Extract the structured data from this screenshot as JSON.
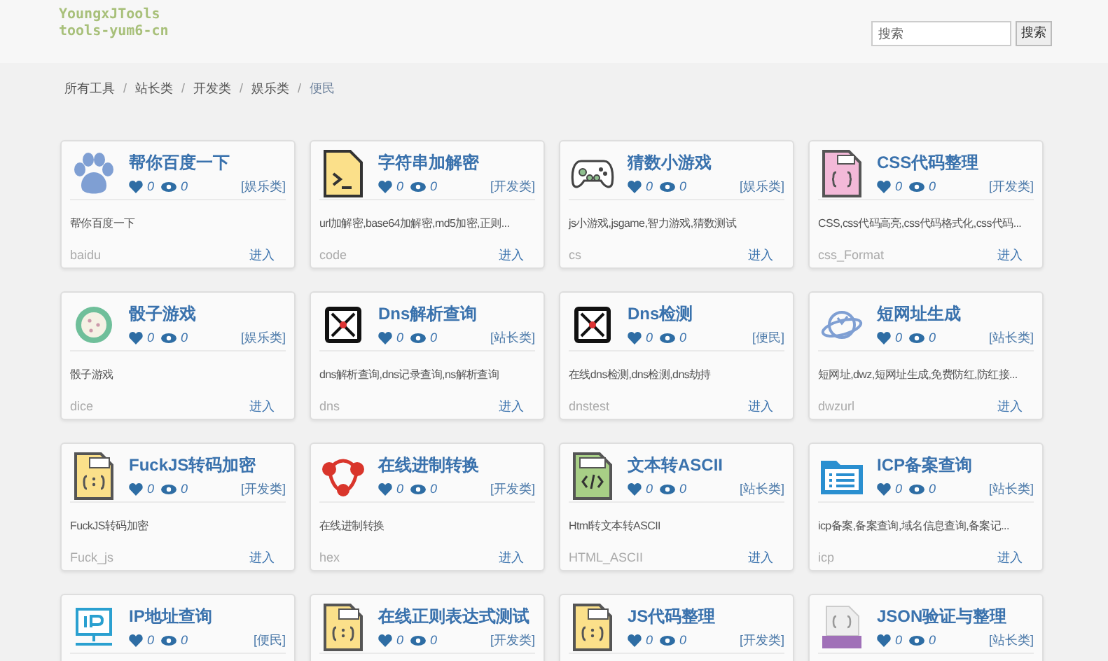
{
  "logo": {
    "name": "YoungxJTools",
    "domain": "tools-yum6-cn"
  },
  "search": {
    "placeholder": "搜索",
    "button": "搜索"
  },
  "breadcrumb": {
    "separator": "/",
    "items": [
      "所有工具",
      "站长类",
      "开发类",
      "娱乐类",
      "便民"
    ]
  },
  "cards": [
    {
      "title": "帮你百度一下",
      "likes": "0",
      "views": "0",
      "category": "[娱乐类]",
      "description": "帮你百度一下",
      "slug": "baidu",
      "link": "进入"
    },
    {
      "title": "字符串加解密",
      "likes": "0",
      "views": "0",
      "category": "[开发类]",
      "description": "url加解密,base64加解密,md5加密,正则...",
      "slug": "code",
      "link": "进入"
    },
    {
      "title": "猜数小游戏",
      "likes": "0",
      "views": "0",
      "category": "[娱乐类]",
      "description": "js小游戏,jsgame,智力游戏,猜数测试",
      "slug": "cs",
      "link": "进入"
    },
    {
      "title": "CSS代码整理",
      "likes": "0",
      "views": "0",
      "category": "[开发类]",
      "description": "CSS,css代码高亮,css代码格式化,css代码...",
      "slug": "css_Format",
      "link": "进入"
    },
    {
      "title": "骰子游戏",
      "likes": "0",
      "views": "0",
      "category": "[娱乐类]",
      "description": "骰子游戏",
      "slug": "dice",
      "link": "进入"
    },
    {
      "title": "Dns解析查询",
      "likes": "0",
      "views": "0",
      "category": "[站长类]",
      "description": "dns解析查询,dns记录查询,ns解析查询",
      "slug": "dns",
      "link": "进入"
    },
    {
      "title": "Dns检测",
      "likes": "0",
      "views": "0",
      "category": "[便民]",
      "description": "在线dns检测,dns检测,dns劫持",
      "slug": "dnstest",
      "link": "进入"
    },
    {
      "title": "短网址生成",
      "likes": "0",
      "views": "0",
      "category": "[站长类]",
      "description": "短网址,dwz,短网址生成,免费防红,防红接...",
      "slug": "dwzurl",
      "link": "进入"
    },
    {
      "title": "FuckJS转码加密",
      "likes": "0",
      "views": "0",
      "category": "[开发类]",
      "description": "FuckJS转码加密",
      "slug": "Fuck_js",
      "link": "进入"
    },
    {
      "title": "在线进制转换",
      "likes": "0",
      "views": "0",
      "category": "[开发类]",
      "description": "在线进制转换",
      "slug": "hex",
      "link": "进入"
    },
    {
      "title": "文本转ASCII",
      "likes": "0",
      "views": "0",
      "category": "[站长类]",
      "description": "Html转文本转ASCII",
      "slug": "HTML_ASCII",
      "link": "进入"
    },
    {
      "title": "ICP备案查询",
      "likes": "0",
      "views": "0",
      "category": "[站长类]",
      "description": "icp备案,备案查询,域名信息查询,备案记...",
      "slug": "icp",
      "link": "进入"
    },
    {
      "title": "IP地址查询",
      "likes": "0",
      "views": "0",
      "category": "[便民]"
    },
    {
      "title": "在线正则表达式测试",
      "likes": "0",
      "views": "0",
      "category": "[开发类]"
    },
    {
      "title": "JS代码整理",
      "likes": "0",
      "views": "0",
      "category": "[开发类]"
    },
    {
      "title": "JSON验证与整理",
      "likes": "0",
      "views": "0",
      "category": "[站长类]"
    }
  ]
}
